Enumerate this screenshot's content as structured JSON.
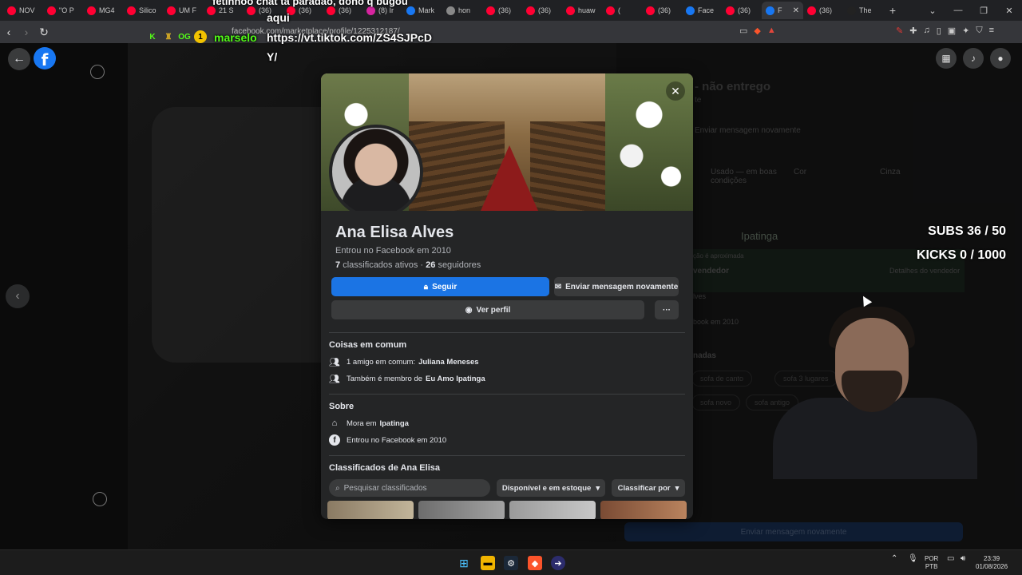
{
  "browser": {
    "tabs": [
      {
        "label": "NOV",
        "icon": "youtube-icon",
        "color": "#ff0033"
      },
      {
        "label": "\"O P",
        "icon": "youtube-icon",
        "color": "#ff0033"
      },
      {
        "label": "MG4",
        "icon": "youtube-icon",
        "color": "#ff0033"
      },
      {
        "label": "Silico",
        "icon": "youtube-icon",
        "color": "#ff0033"
      },
      {
        "label": "UM F",
        "icon": "youtube-icon",
        "color": "#ff0033"
      },
      {
        "label": "21 S",
        "icon": "youtube-icon",
        "color": "#ff0033"
      },
      {
        "label": "(36)",
        "icon": "youtube-icon",
        "color": "#ff0033"
      },
      {
        "label": "(36)",
        "icon": "youtube-icon",
        "color": "#ff0033"
      },
      {
        "label": "(36)",
        "icon": "youtube-icon",
        "color": "#ff0033"
      },
      {
        "label": "(8) Ir",
        "icon": "instagram-icon",
        "color": "#d6249f"
      },
      {
        "label": "Mark",
        "icon": "facebook-icon",
        "color": "#1877f2"
      },
      {
        "label": "hon",
        "icon": "google-icon",
        "color": "#888888"
      },
      {
        "label": "(36)",
        "icon": "youtube-icon",
        "color": "#ff0033"
      },
      {
        "label": "(36)",
        "icon": "youtube-icon",
        "color": "#ff0033"
      },
      {
        "label": "huaw",
        "icon": "youtube-icon",
        "color": "#ff0033"
      },
      {
        "label": "(",
        "icon": "youtube-icon",
        "color": "#ff0033"
      },
      {
        "label": "(36)",
        "icon": "youtube-icon",
        "color": "#ff0033"
      },
      {
        "label": "Face",
        "icon": "facebook-icon",
        "color": "#1877f2"
      },
      {
        "label": "(36)",
        "icon": "youtube-icon",
        "color": "#ff0033"
      },
      {
        "label": "F",
        "icon": "facebook-icon",
        "color": "#1877f2",
        "active": true
      },
      {
        "label": "(36)",
        "icon": "youtube-icon",
        "color": "#ff0033"
      },
      {
        "label": "The",
        "icon": "tiktok-icon",
        "color": "#222222"
      }
    ],
    "url": "facebook.com/marketplace/profile/1225312187/"
  },
  "stream_overlay": {
    "chat_line1": "fetinhoo  chat ta paradao, dono q bugou",
    "chat_word": "aqui",
    "chat_user": "marselo",
    "chat_link": "https://vt.tiktok.com/ZS4SJPcD",
    "chat_link_tail": "Y/",
    "badge_count": "1",
    "subs": "SUBS 36 / 50",
    "kicks": "KICKS 0 / 1000"
  },
  "background_listing": {
    "title_fragment": "- não entrego",
    "subtitle_fragment": "te",
    "send_again": "Enviar mensagem novamente",
    "condition_label": "Usado — em boas condições",
    "color_label": "Cor",
    "color_value": "Cinza",
    "map_city": "Ipatinga",
    "approx_location": "ção é aproximada",
    "seller_heading": "vendedor",
    "seller_details": "Detalhes do vendedor",
    "seller_name_fragment": "lves",
    "seller_joined_fragment": "book em 2010",
    "related_heading": "nadas",
    "chips": [
      "sofa de canto",
      "sofa 3 lugares",
      "sofa novo",
      "sofa antigo"
    ],
    "send_button": "Enviar mensagem novamente"
  },
  "profile": {
    "name": "Ana Elisa Alves",
    "joined": "Entrou no Facebook em 2010",
    "listings_count": "7",
    "listings_label": "classificados ativos ·",
    "followers_count": "26",
    "followers_label": "seguidores",
    "follow_button": "Seguir",
    "message_button": "Enviar mensagem novamente",
    "profile_button": "Ver perfil",
    "more_button": "···",
    "common_heading": "Coisas em comum",
    "mutual_friend_prefix": "1 amigo em comum:",
    "mutual_friend_name": "Juliana Meneses",
    "group_prefix": "Também é membro de",
    "group_name": "Eu Amo Ipatinga",
    "about_heading": "Sobre",
    "lives_prefix": "Mora em",
    "lives_city": "Ipatinga",
    "about_joined": "Entrou no Facebook em 2010",
    "listings_heading": "Classificados de Ana Elisa",
    "search_placeholder": "Pesquisar classificados",
    "availability_filter": "Disponível e em estoque",
    "sort_filter": "Classificar por"
  },
  "taskbar": {
    "language": "POR",
    "layout": "PTB",
    "time": "23:39",
    "date": "01/08/2026"
  }
}
